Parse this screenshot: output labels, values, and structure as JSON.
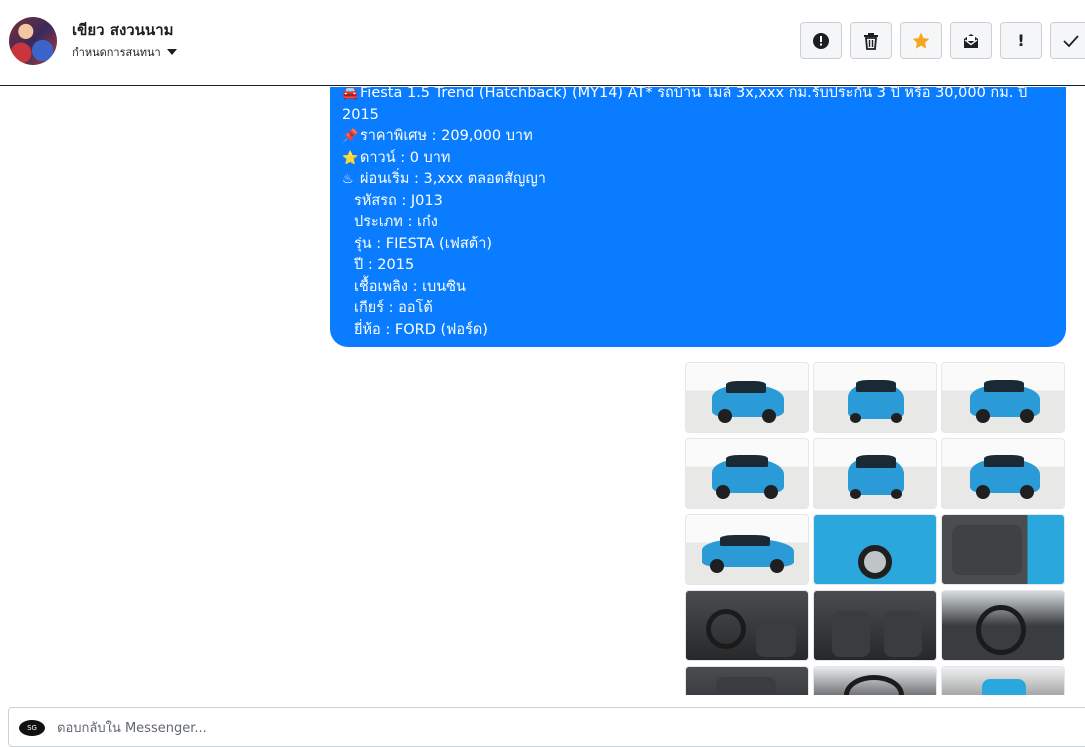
{
  "header": {
    "contact_name": "เขียว สงวนนาม",
    "assign_label": "กำหนดการสนทนา",
    "actions": [
      {
        "icon": "alert-circle-icon",
        "glyph": "!"
      },
      {
        "icon": "trash-icon",
        "glyph": "🗑"
      },
      {
        "icon": "star-icon",
        "glyph": "★",
        "color": "#f5a623"
      },
      {
        "icon": "mark-unread-icon",
        "glyph": "✉"
      },
      {
        "icon": "exclamation-icon",
        "glyph": "!"
      },
      {
        "icon": "check-icon",
        "glyph": "✓"
      }
    ]
  },
  "message": {
    "bubble_color": "#0a7cff",
    "title_emoji": "🚘",
    "title": "Fiesta 1.5 Trend (Hatchback) (MY14) AT* รถบ้าน ไมล์ 3x,xxx กม.รับประกัน 3 ปี หรือ 30,000 กม. ปี 2015",
    "price_emoji": "📌",
    "price": "ราคาพิเศษ : 209,000 บาท",
    "down_emoji": "⭐",
    "down": "ดาวน์ : 0 บาท",
    "installment_emoji": "♨",
    "installment": "ผ่อนเริ่ม : 3,xxx ตลอดสัญญา",
    "details": [
      "รหัสรถ : J013",
      "ประเภท : เก๋ง",
      "รุ่น : FIESTA (เฟสต้า)",
      "ปี : 2015",
      "เชื้อเพลิง : เบนซิน",
      "เกียร์ : ออโต้",
      "ยี่ห้อ : FORD (ฟอร์ด)"
    ]
  },
  "photos": {
    "count": 15,
    "kinds": [
      "ext",
      "ext",
      "ext",
      "ext",
      "ext",
      "ext",
      "ext",
      "ext-close",
      "int-door",
      "int",
      "int",
      "int",
      "int",
      "int",
      "int"
    ]
  },
  "composer": {
    "logo_text": "SG",
    "placeholder": "ตอบกลับใน Messenger..."
  }
}
